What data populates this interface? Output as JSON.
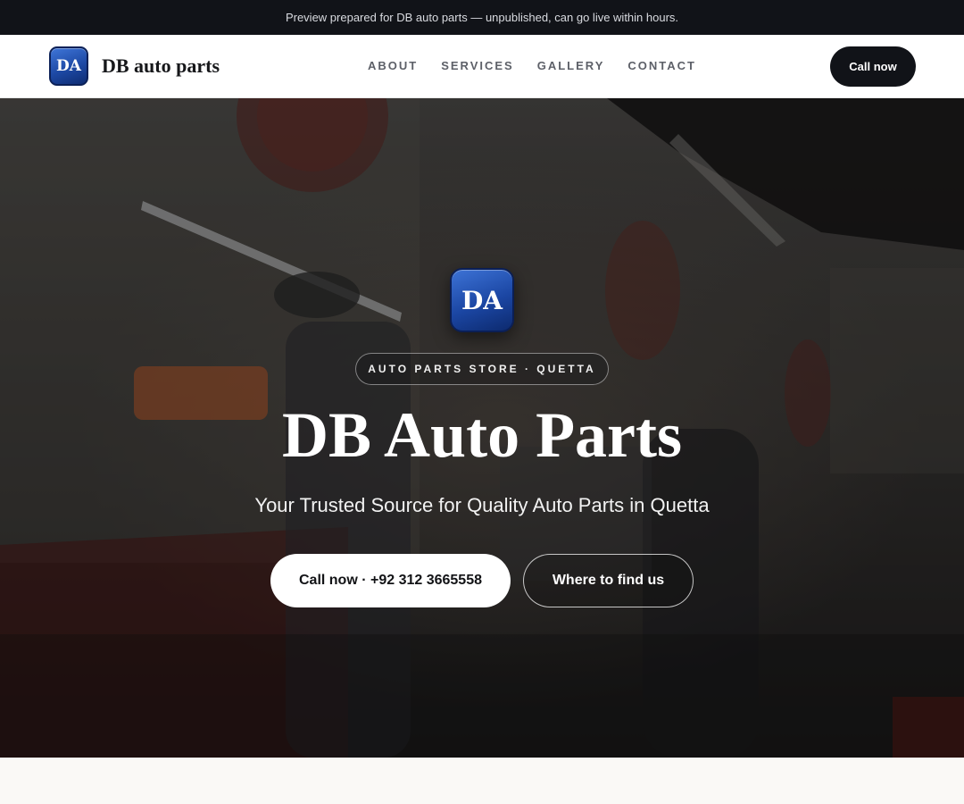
{
  "banner": {
    "text": "Preview prepared for DB auto parts — unpublished, can go live within hours."
  },
  "nav": {
    "logo_initials": "DA",
    "brand": "DB auto parts",
    "links": [
      "ABOUT",
      "SERVICES",
      "GALLERY",
      "CONTACT"
    ],
    "cta": "Call now"
  },
  "hero": {
    "badge_initials": "DA",
    "eyebrow": "AUTO PARTS STORE · QUETTA",
    "title": "DB Auto Parts",
    "subtitle": "Your Trusted Source for Quality Auto Parts in Quetta",
    "primary_button": "Call now · +92 312 3665558",
    "secondary_button": "Where to find us",
    "background": "garage-workshop-photo"
  },
  "colors": {
    "banner_bg": "#111318",
    "accent_dark": "#111318",
    "badge_blue": "#1d49a5",
    "page_bg": "#faf9f6"
  }
}
